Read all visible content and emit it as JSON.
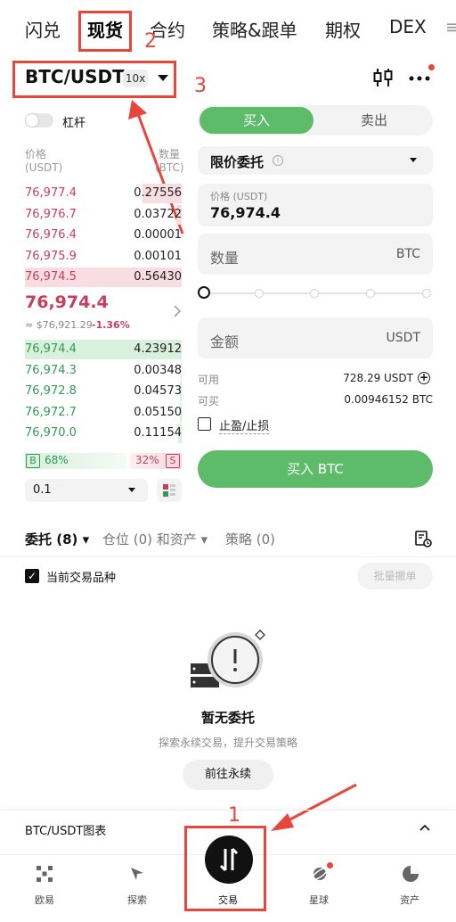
{
  "top_tabs": [
    "闪兑",
    "现货",
    "合约",
    "策略&跟单",
    "期权",
    "DEX"
  ],
  "annotations": {
    "n1": "1",
    "n2": "2",
    "n3": "3"
  },
  "pair": {
    "symbol": "BTC/USDT",
    "leverage": "10x"
  },
  "margin_toggle_label": "杠杆",
  "orderbook": {
    "header_price": "价格",
    "header_price_unit": "(USDT)",
    "header_qty": "数量",
    "header_qty_unit": "(BTC)",
    "asks": [
      {
        "price": "76,977.4",
        "qty": "0.27556",
        "depth": 0.5
      },
      {
        "price": "76,976.7",
        "qty": "0.03722",
        "depth": 0.07
      },
      {
        "price": "76,976.4",
        "qty": "0.00001",
        "depth": 0.0
      },
      {
        "price": "76,975.9",
        "qty": "0.00101",
        "depth": 0.0
      },
      {
        "price": "76,974.5",
        "qty": "0.56430",
        "depth": 1.0
      }
    ],
    "last_price": "76,974.4",
    "last_price_usd": "≈ $76,921.29",
    "change": "-1.36%",
    "bids": [
      {
        "price": "76,974.4",
        "qty": "4.23912",
        "depth": 1.0
      },
      {
        "price": "76,974.3",
        "qty": "0.00348",
        "depth": 0.01
      },
      {
        "price": "76,972.8",
        "qty": "0.04573",
        "depth": 0.02
      },
      {
        "price": "76,972.7",
        "qty": "0.05150",
        "depth": 0.02
      },
      {
        "price": "76,970.0",
        "qty": "0.11154",
        "depth": 0.04
      }
    ],
    "ratio_b_label": "B",
    "ratio_b": "68%",
    "ratio_s": "32%",
    "ratio_s_label": "S",
    "precision": "0.1"
  },
  "order_form": {
    "buy_tab": "买入",
    "sell_tab": "卖出",
    "order_type": "限价委托",
    "price_label": "价格 (USDT)",
    "price_value": "76,974.4",
    "qty_placeholder": "数量",
    "qty_unit": "BTC",
    "amount_placeholder": "金额",
    "amount_unit": "USDT",
    "available_label": "可用",
    "available_value": "728.29 USDT",
    "can_buy_label": "可买",
    "can_buy_value": "0.00946152 BTC",
    "tpsl_label": "止盈/止损",
    "submit": "买入 BTC"
  },
  "orders_tabs": {
    "orders": "委托 (8)",
    "positions": "仓位 (0) 和资产",
    "strategy": "策略 (0)"
  },
  "current_pair_filter": "当前交易品种",
  "batch_cancel": "批量撤单",
  "empty": {
    "title": "暂无委托",
    "subtitle": "探索永续交易，提升交易策略",
    "button": "前往永续"
  },
  "chart_section": "BTC/USDT图表",
  "bottom_nav": [
    "欧易",
    "探索",
    "交易",
    "星球",
    "资产"
  ],
  "colors": {
    "green": "#5dbb6a",
    "red": "#c83e5a",
    "annotation": "#e8453c"
  }
}
